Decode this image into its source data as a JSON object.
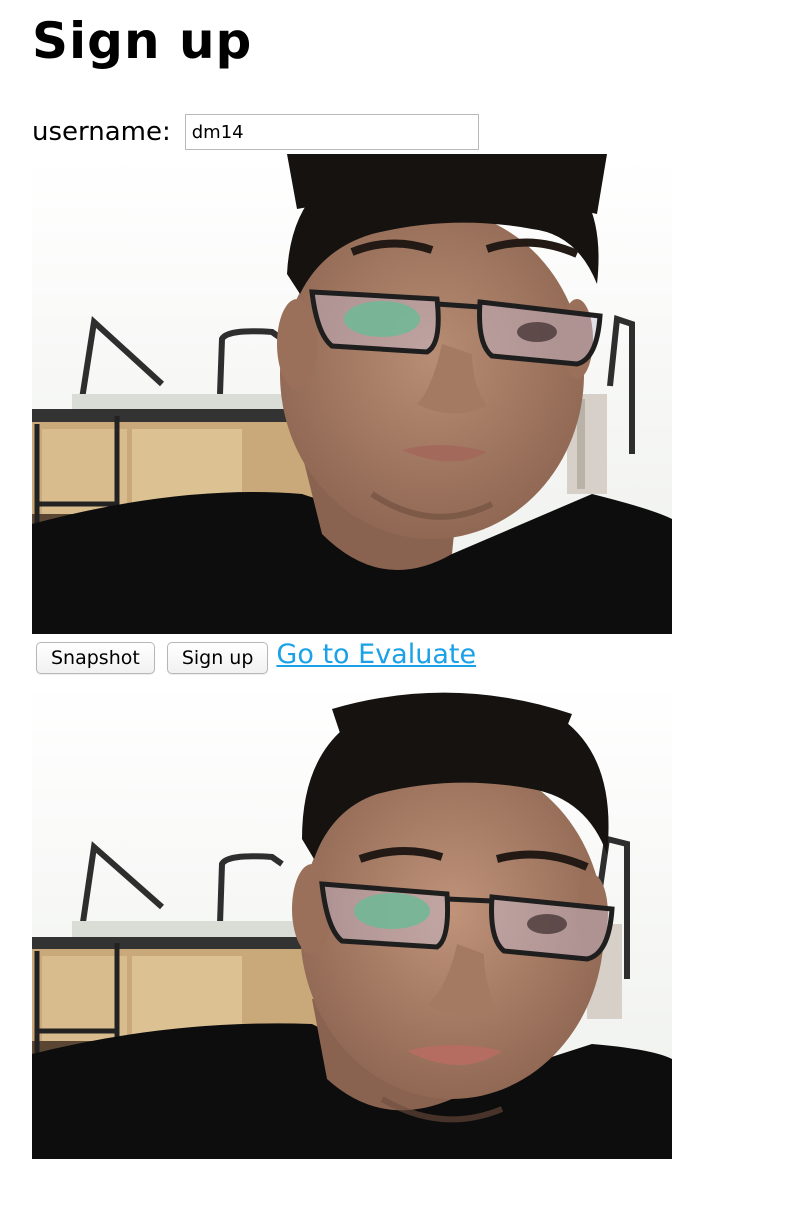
{
  "page": {
    "title": "Sign up"
  },
  "form": {
    "username_label": "username:",
    "username_value": "dm14"
  },
  "controls": {
    "snapshot_label": "Snapshot",
    "signup_label": "Sign up",
    "evaluate_link": "Go to Evaluate"
  },
  "colors": {
    "link": "#1aa1e8",
    "input_border": "#b9b9b9",
    "background": "#ffffff"
  }
}
